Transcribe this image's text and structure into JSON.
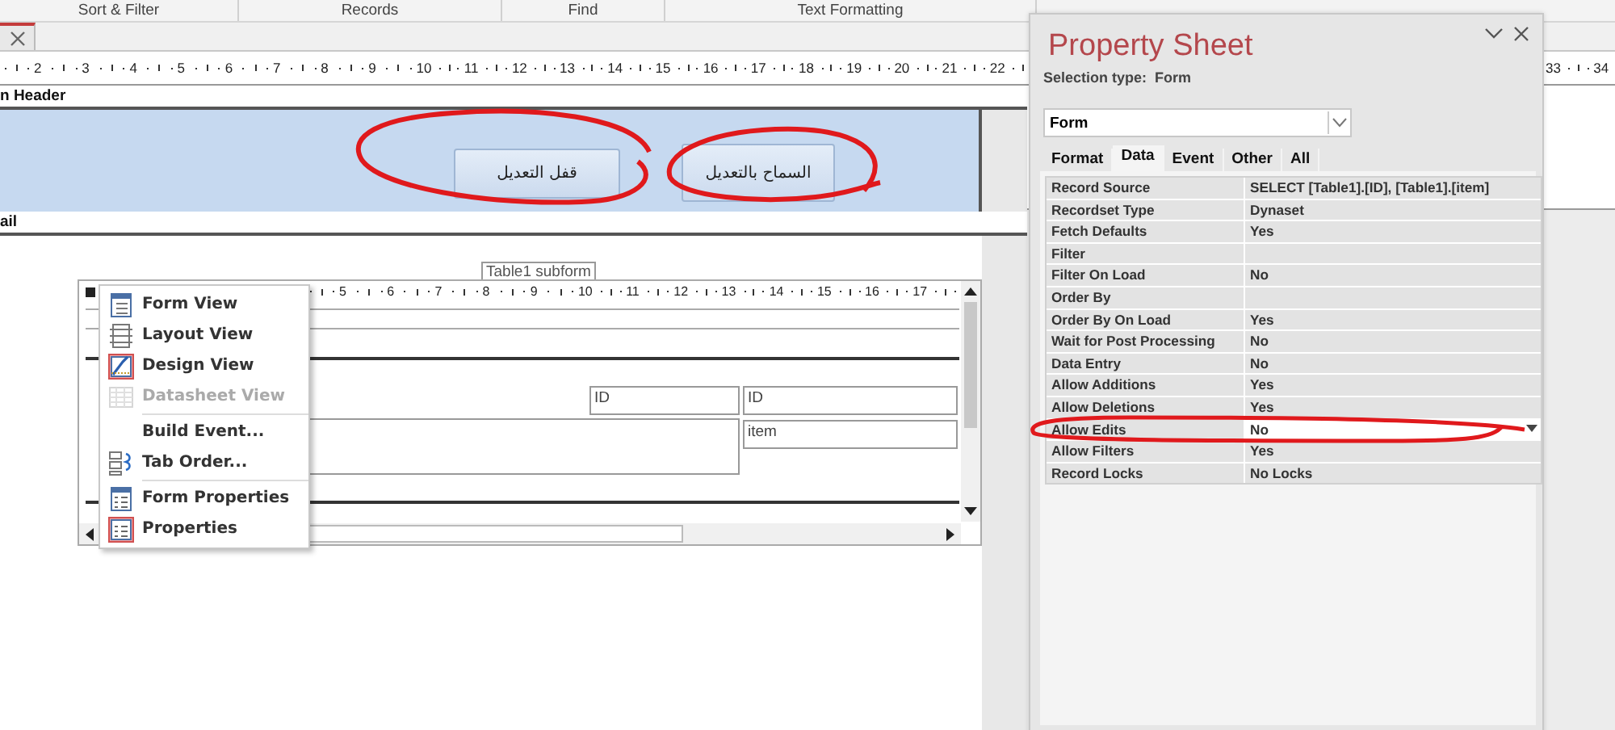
{
  "ribbon_groups": [
    {
      "label": "Sort & Filter"
    },
    {
      "label": "Records"
    },
    {
      "label": "Find"
    },
    {
      "label": "Text Formatting"
    }
  ],
  "ruler": {
    "numbers": [
      "2",
      "3",
      "4",
      "5",
      "6",
      "7",
      "8",
      "9",
      "10",
      "11",
      "12",
      "13",
      "14",
      "15",
      "16",
      "17",
      "18",
      "19",
      "20",
      "21",
      "22"
    ],
    "right_numbers": [
      "33",
      "34"
    ]
  },
  "header_section": {
    "label": "n Header",
    "buttons": [
      {
        "label": "السماح بالتعديل"
      },
      {
        "label": "قفل التعديل"
      }
    ]
  },
  "detail_section": {
    "label": "ail"
  },
  "subform": {
    "label": "Table1 subform",
    "ruler": [
      "5",
      "6",
      "7",
      "8",
      "9",
      "10",
      "11",
      "12",
      "13",
      "14",
      "15",
      "16",
      "17"
    ],
    "id_label": "ID",
    "id_field": "ID",
    "item_field": "item"
  },
  "context_menu": {
    "groups": [
      [
        {
          "label": "Form View",
          "kind": "form",
          "disabled": false
        },
        {
          "label": "Layout View",
          "kind": "layout",
          "disabled": false
        },
        {
          "label": "Design View",
          "kind": "design",
          "disabled": false
        },
        {
          "label": "Datasheet View",
          "kind": "datasheet",
          "disabled": true
        }
      ],
      [
        {
          "label": "Build Event...",
          "kind": "plain",
          "disabled": false
        },
        {
          "label": "Tab Order...",
          "kind": "tab-order",
          "disabled": false
        }
      ],
      [
        {
          "label": "Form Properties",
          "kind": "form-properties",
          "disabled": false
        },
        {
          "label": "Properties",
          "kind": "properties",
          "disabled": false
        }
      ]
    ]
  },
  "property_sheet": {
    "title": "Property Sheet",
    "selection_label": "Selection type:",
    "selection_type": "Form",
    "object": "Form",
    "tabs": [
      {
        "label": "Format",
        "selected": false
      },
      {
        "label": "Data",
        "selected": true
      },
      {
        "label": "Event",
        "selected": false
      },
      {
        "label": "Other",
        "selected": false
      },
      {
        "label": "All",
        "selected": false
      }
    ],
    "rows": [
      {
        "name": "Record Source",
        "value": "SELECT [Table1].[ID], [Table1].[item]",
        "selected": false
      },
      {
        "name": "Recordset Type",
        "value": "Dynaset",
        "selected": false
      },
      {
        "name": "Fetch Defaults",
        "value": "Yes",
        "selected": false
      },
      {
        "name": "Filter",
        "selected": false
      },
      {
        "name": "Filter On Load",
        "value": "No",
        "selected": false
      },
      {
        "name": "Order By",
        "selected": false
      },
      {
        "name": "Order By On Load",
        "value": "Yes",
        "selected": false
      },
      {
        "name": "Wait for Post Processing",
        "value": "No",
        "selected": false
      },
      {
        "name": "Data Entry",
        "value": "No",
        "selected": false
      },
      {
        "name": "Allow Additions",
        "value": "Yes",
        "selected": false
      },
      {
        "name": "Allow Deletions",
        "value": "Yes",
        "selected": false
      },
      {
        "name": "Allow Edits",
        "value": "No",
        "selected": true
      },
      {
        "name": "Allow Filters",
        "value": "Yes",
        "selected": false
      },
      {
        "name": "Record Locks",
        "value": "No Locks",
        "selected": false
      }
    ]
  }
}
